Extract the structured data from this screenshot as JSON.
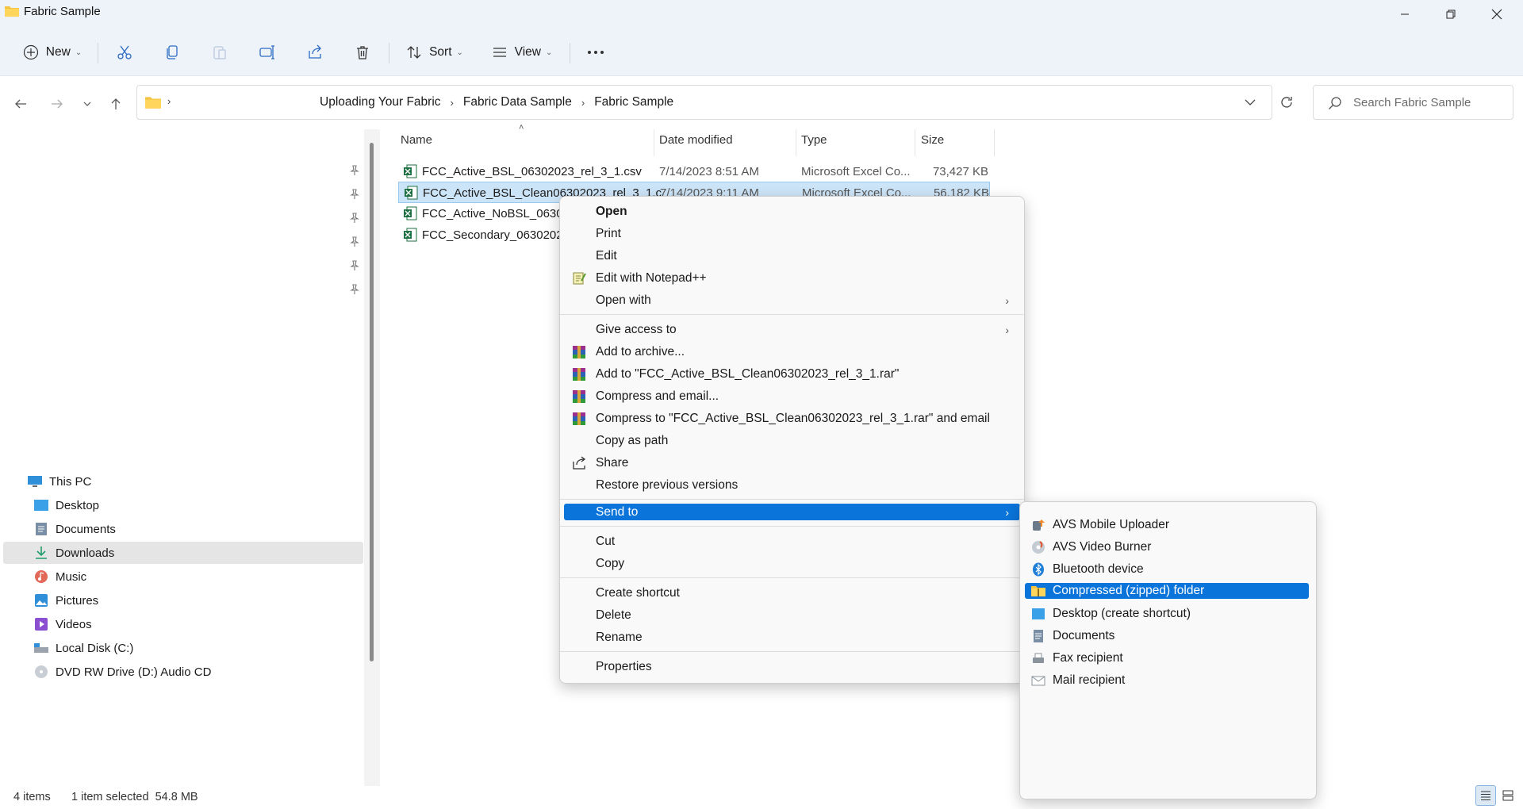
{
  "window": {
    "title": "Fabric Sample"
  },
  "toolbar": {
    "new_label": "New",
    "sort_label": "Sort",
    "view_label": "View"
  },
  "address": {
    "crumbs": [
      "Uploading Your Fabric",
      "Fabric Data Sample",
      "Fabric Sample"
    ]
  },
  "search": {
    "placeholder": "Search Fabric Sample"
  },
  "nav": {
    "items": [
      {
        "label": "This PC",
        "icon": "pc-icon"
      },
      {
        "label": "Desktop",
        "icon": "desktop-icon"
      },
      {
        "label": "Documents",
        "icon": "documents-icon"
      },
      {
        "label": "Downloads",
        "icon": "downloads-icon"
      },
      {
        "label": "Music",
        "icon": "music-icon"
      },
      {
        "label": "Pictures",
        "icon": "pictures-icon"
      },
      {
        "label": "Videos",
        "icon": "videos-icon"
      },
      {
        "label": "Local Disk (C:)",
        "icon": "disk-icon"
      },
      {
        "label": "DVD RW Drive (D:) Audio CD",
        "icon": "dvd-icon"
      }
    ]
  },
  "columns": {
    "name": "Name",
    "date": "Date modified",
    "type": "Type",
    "size": "Size"
  },
  "files": [
    {
      "name": "FCC_Active_BSL_06302023_rel_3_1.csv",
      "date": "7/14/2023 8:51 AM",
      "type": "Microsoft Excel Co...",
      "size": "73,427 KB"
    },
    {
      "name": "FCC_Active_BSL_Clean06302023_rel_3_1.c",
      "date": "7/14/2023 9:11 AM",
      "type": "Microsoft Excel Co...",
      "size": "56,182 KB"
    },
    {
      "name": "FCC_Active_NoBSL_06302",
      "date": "",
      "type": "",
      "size": ""
    },
    {
      "name": "FCC_Secondary_06302023",
      "date": "",
      "type": "",
      "size": ""
    }
  ],
  "context_menu": {
    "open": "Open",
    "print": "Print",
    "edit": "Edit",
    "edit_notepad": "Edit with Notepad++",
    "open_with": "Open with",
    "give_access": "Give access to",
    "add_archive": "Add to archive...",
    "add_rar": "Add to \"FCC_Active_BSL_Clean06302023_rel_3_1.rar\"",
    "compress_email": "Compress and email...",
    "compress_rar_email": "Compress to \"FCC_Active_BSL_Clean06302023_rel_3_1.rar\" and email",
    "copy_path": "Copy as path",
    "share": "Share",
    "restore": "Restore previous versions",
    "send_to": "Send to",
    "cut": "Cut",
    "copy": "Copy",
    "create_shortcut": "Create shortcut",
    "delete": "Delete",
    "rename": "Rename",
    "properties": "Properties"
  },
  "send_to": [
    "AVS Mobile Uploader",
    "AVS Video Burner",
    "Bluetooth device",
    "Compressed (zipped) folder",
    "Desktop (create shortcut)",
    "Documents",
    "Fax recipient",
    "Mail recipient"
  ],
  "status": {
    "items": "4 items",
    "selected": "1 item selected  54.8 MB"
  },
  "colors": {
    "accent": "#0a74da",
    "selection": "#cce4f7",
    "excel": "#1d6f42",
    "folder": "#f5c342"
  }
}
